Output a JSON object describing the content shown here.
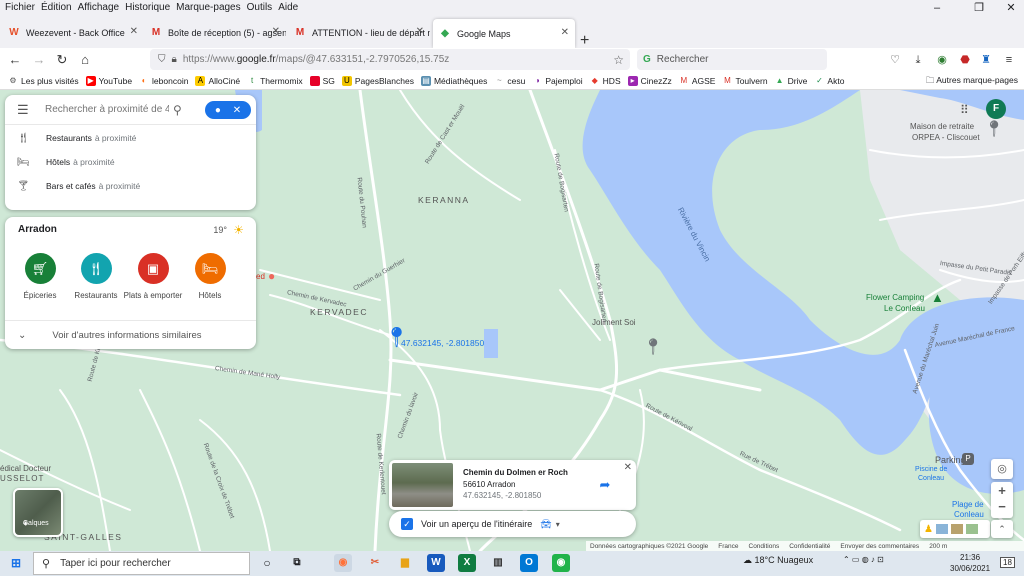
{
  "menu": [
    "Fichier",
    "Édition",
    "Affichage",
    "Historique",
    "Marque-pages",
    "Outils",
    "Aide"
  ],
  "window_controls": [
    "–",
    "❐",
    "✕"
  ],
  "tabs": [
    {
      "title": "Weezevent - Back Office",
      "icon": "W",
      "color": "#e6502a"
    },
    {
      "title": "Boîte de réception (5) - agsenau",
      "icon": "M",
      "color": "#d93025"
    },
    {
      "title": "ATTENTION - lieu de départ mo",
      "icon": "M",
      "color": "#d93025"
    },
    {
      "title": "Google Maps",
      "icon": "◆",
      "color": "#34a853"
    }
  ],
  "url": {
    "prefix": "https://www.",
    "domain": "google.fr",
    "path": "/maps/@47.633151,-2.7970526,15.75z"
  },
  "browser_search_placeholder": "Rechercher",
  "bookmarks": [
    {
      "label": "Les plus visités",
      "icon": "⚙",
      "color": "#555"
    },
    {
      "label": "YouTube",
      "icon": "▶",
      "color": "#ff0000"
    },
    {
      "label": "leboncoin",
      "icon": "◐",
      "color": "#ff6e14"
    },
    {
      "label": "AlloCiné",
      "icon": "A",
      "color": "#fecc00"
    },
    {
      "label": "Thermomix",
      "icon": "t",
      "color": "#2b8a3e"
    },
    {
      "label": "SG",
      "icon": "■",
      "color": "#e60028"
    },
    {
      "label": "PagesBlanches",
      "icon": "U",
      "color": "#f2c500"
    },
    {
      "label": "Médiathèques",
      "icon": "▤",
      "color": "#5a8fb0"
    },
    {
      "label": "cesu",
      "icon": "~",
      "color": "#888"
    },
    {
      "label": "Pajemploi",
      "icon": "◑",
      "color": "#7b1fa2"
    },
    {
      "label": "HDS",
      "icon": "◆",
      "color": "#e63b2e"
    },
    {
      "label": "CinezZz",
      "icon": "▸",
      "color": "#9c27b0"
    },
    {
      "label": "AGSE",
      "icon": "M",
      "color": "#d93025"
    },
    {
      "label": "Toulvern",
      "icon": "M",
      "color": "#d93025"
    },
    {
      "label": "Drive",
      "icon": "▲",
      "color": "#34a853"
    },
    {
      "label": "Akto",
      "icon": "✓",
      "color": "#1a8a4a"
    }
  ],
  "other_bookmarks": "Autres marque-pages",
  "search": {
    "placeholder": "Rechercher à proximité de 47",
    "suggestions": [
      {
        "icon": "🍴",
        "name": "Restaurants",
        "suffix": "à proximité"
      },
      {
        "icon": "🛏",
        "name": "Hôtels",
        "suffix": "à proximité"
      },
      {
        "icon": "🍸",
        "name": "Bars et cafés",
        "suffix": "à proximité"
      }
    ]
  },
  "area": {
    "name": "Arradon",
    "temperature": "19°",
    "categories": [
      {
        "label": "Épiceries",
        "icon": "🛒",
        "color": "#188038"
      },
      {
        "label": "Restaurants",
        "icon": "🍴",
        "color": "#12a4af"
      },
      {
        "label": "Plats à emporter",
        "icon": "🥡",
        "color": "#d93025"
      },
      {
        "label": "Hôtels",
        "icon": "🛏",
        "color": "#ef6c00"
      }
    ],
    "more": "Voir d'autres informations similaires"
  },
  "map_labels": {
    "keranna": "KERANNA",
    "kervadec": "KERVADEC",
    "saint_galles": "SAINT-GALLES",
    "riviere": "Rivière du Vincin",
    "joliment": "Joliment Soi",
    "maison": "Maison de retraite",
    "orpea": "ORPEA - Cliscouet",
    "flower1": "Flower Camping",
    "flower2": "Le Conleau",
    "parking": "Parking",
    "piscine1": "Piscine de",
    "piscine2": "Conleau",
    "plage1": "Plage de",
    "plage2": "Conleau",
    "medical1": "édical Docteur",
    "medical2": "USSELOT",
    "ed": "ed",
    "pin_coords": "47.632145, -2.801850",
    "chemin_du_pouhan": "Route du Pouhan",
    "allee": "Route de Cast er Mouël",
    "rue_bogisarten": "Route de Bogisarten",
    "chemin_ker": "Chemin de Kervadec",
    "route_guerhier": "Chemin du Guerhier",
    "chemin_hoty": "Chemin de Mané Holly",
    "route_trebet": "Route de la Croix de Trébet",
    "route_kerlabous": "Route de Kerlabous",
    "lavoir": "Chemin du lavoir",
    "route_brouel": "Route de Bogisarten",
    "route_kerbouc": "Route de Kérivoal",
    "rue_trebet": "Rue de Trébet",
    "lentouet": "Route de Kerlentouet",
    "porte": "Impasse de Porh Eiffel",
    "pres": "Impasse du Petit Paradis",
    "jean": "Avenue du Maréchal Juin",
    "mar": "Avenue Maréchal de France"
  },
  "place_card": {
    "name": "Chemin du Dolmen er Roch",
    "address": "56610 Arradon",
    "coords": "47.632145, -2.801850"
  },
  "itinerary": "Voir un aperçu de l'itinéraire",
  "layers_label": "Calques",
  "avatar_letter": "F",
  "footer": [
    "Données cartographiques ©2021 Google",
    "France",
    "Conditions",
    "Confidentialité",
    "Envoyer des commentaires",
    "200 m"
  ],
  "taskbar": {
    "search_placeholder": "Taper ici pour rechercher",
    "weather": "18°C  Nuageux",
    "time": "21:36",
    "date": "30/06/2021",
    "notif_count": "18"
  }
}
